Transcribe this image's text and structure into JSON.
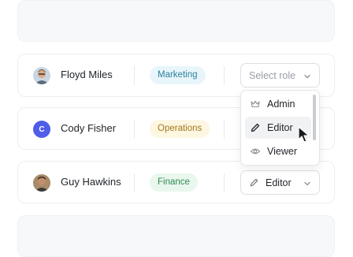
{
  "rows": [
    {
      "name": "Floyd Miles",
      "department": "Marketing",
      "department_colors": {
        "bg": "#e8f6fb",
        "fg": "#2b7f9a"
      },
      "role_value": "",
      "role_placeholder": "Select role"
    },
    {
      "name": "Cody Fisher",
      "avatar_initial": "C",
      "department": "Operations",
      "department_colors": {
        "bg": "#fdf6e1",
        "fg": "#a07a1c"
      },
      "role_value": ""
    },
    {
      "name": "Guy Hawkins",
      "department": "Finance",
      "department_colors": {
        "bg": "#e9f7ee",
        "fg": "#2f8a4f"
      },
      "role_value": "Editor"
    }
  ],
  "role_menu": {
    "items": [
      {
        "label": "Admin",
        "icon": "crown-icon"
      },
      {
        "label": "Editor",
        "icon": "pencil-icon",
        "highlighted": true
      },
      {
        "label": "Viewer",
        "icon": "eye-icon"
      }
    ]
  },
  "colors": {
    "avatar_initial_bg": "#4f5de8",
    "placeholder_text": "#9aa0a6"
  }
}
